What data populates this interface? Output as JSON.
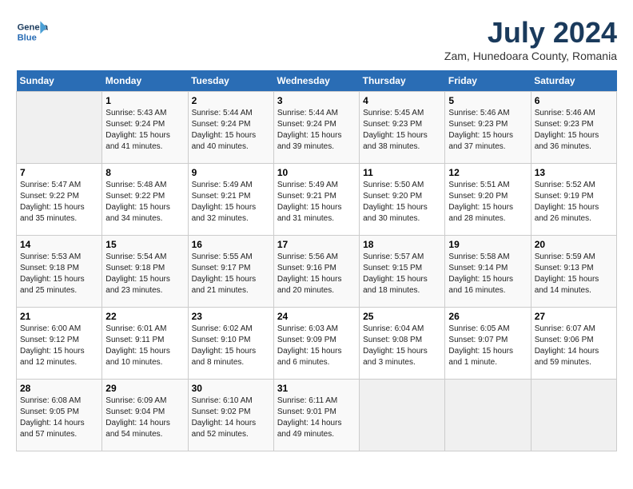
{
  "header": {
    "logo_line1": "General",
    "logo_line2": "Blue",
    "month_year": "July 2024",
    "location": "Zam, Hunedoara County, Romania"
  },
  "weekdays": [
    "Sunday",
    "Monday",
    "Tuesday",
    "Wednesday",
    "Thursday",
    "Friday",
    "Saturday"
  ],
  "weeks": [
    [
      {
        "day": "",
        "info": ""
      },
      {
        "day": "1",
        "info": "Sunrise: 5:43 AM\nSunset: 9:24 PM\nDaylight: 15 hours\nand 41 minutes."
      },
      {
        "day": "2",
        "info": "Sunrise: 5:44 AM\nSunset: 9:24 PM\nDaylight: 15 hours\nand 40 minutes."
      },
      {
        "day": "3",
        "info": "Sunrise: 5:44 AM\nSunset: 9:24 PM\nDaylight: 15 hours\nand 39 minutes."
      },
      {
        "day": "4",
        "info": "Sunrise: 5:45 AM\nSunset: 9:23 PM\nDaylight: 15 hours\nand 38 minutes."
      },
      {
        "day": "5",
        "info": "Sunrise: 5:46 AM\nSunset: 9:23 PM\nDaylight: 15 hours\nand 37 minutes."
      },
      {
        "day": "6",
        "info": "Sunrise: 5:46 AM\nSunset: 9:23 PM\nDaylight: 15 hours\nand 36 minutes."
      }
    ],
    [
      {
        "day": "7",
        "info": "Sunrise: 5:47 AM\nSunset: 9:22 PM\nDaylight: 15 hours\nand 35 minutes."
      },
      {
        "day": "8",
        "info": "Sunrise: 5:48 AM\nSunset: 9:22 PM\nDaylight: 15 hours\nand 34 minutes."
      },
      {
        "day": "9",
        "info": "Sunrise: 5:49 AM\nSunset: 9:21 PM\nDaylight: 15 hours\nand 32 minutes."
      },
      {
        "day": "10",
        "info": "Sunrise: 5:49 AM\nSunset: 9:21 PM\nDaylight: 15 hours\nand 31 minutes."
      },
      {
        "day": "11",
        "info": "Sunrise: 5:50 AM\nSunset: 9:20 PM\nDaylight: 15 hours\nand 30 minutes."
      },
      {
        "day": "12",
        "info": "Sunrise: 5:51 AM\nSunset: 9:20 PM\nDaylight: 15 hours\nand 28 minutes."
      },
      {
        "day": "13",
        "info": "Sunrise: 5:52 AM\nSunset: 9:19 PM\nDaylight: 15 hours\nand 26 minutes."
      }
    ],
    [
      {
        "day": "14",
        "info": "Sunrise: 5:53 AM\nSunset: 9:18 PM\nDaylight: 15 hours\nand 25 minutes."
      },
      {
        "day": "15",
        "info": "Sunrise: 5:54 AM\nSunset: 9:18 PM\nDaylight: 15 hours\nand 23 minutes."
      },
      {
        "day": "16",
        "info": "Sunrise: 5:55 AM\nSunset: 9:17 PM\nDaylight: 15 hours\nand 21 minutes."
      },
      {
        "day": "17",
        "info": "Sunrise: 5:56 AM\nSunset: 9:16 PM\nDaylight: 15 hours\nand 20 minutes."
      },
      {
        "day": "18",
        "info": "Sunrise: 5:57 AM\nSunset: 9:15 PM\nDaylight: 15 hours\nand 18 minutes."
      },
      {
        "day": "19",
        "info": "Sunrise: 5:58 AM\nSunset: 9:14 PM\nDaylight: 15 hours\nand 16 minutes."
      },
      {
        "day": "20",
        "info": "Sunrise: 5:59 AM\nSunset: 9:13 PM\nDaylight: 15 hours\nand 14 minutes."
      }
    ],
    [
      {
        "day": "21",
        "info": "Sunrise: 6:00 AM\nSunset: 9:12 PM\nDaylight: 15 hours\nand 12 minutes."
      },
      {
        "day": "22",
        "info": "Sunrise: 6:01 AM\nSunset: 9:11 PM\nDaylight: 15 hours\nand 10 minutes."
      },
      {
        "day": "23",
        "info": "Sunrise: 6:02 AM\nSunset: 9:10 PM\nDaylight: 15 hours\nand 8 minutes."
      },
      {
        "day": "24",
        "info": "Sunrise: 6:03 AM\nSunset: 9:09 PM\nDaylight: 15 hours\nand 6 minutes."
      },
      {
        "day": "25",
        "info": "Sunrise: 6:04 AM\nSunset: 9:08 PM\nDaylight: 15 hours\nand 3 minutes."
      },
      {
        "day": "26",
        "info": "Sunrise: 6:05 AM\nSunset: 9:07 PM\nDaylight: 15 hours\nand 1 minute."
      },
      {
        "day": "27",
        "info": "Sunrise: 6:07 AM\nSunset: 9:06 PM\nDaylight: 14 hours\nand 59 minutes."
      }
    ],
    [
      {
        "day": "28",
        "info": "Sunrise: 6:08 AM\nSunset: 9:05 PM\nDaylight: 14 hours\nand 57 minutes."
      },
      {
        "day": "29",
        "info": "Sunrise: 6:09 AM\nSunset: 9:04 PM\nDaylight: 14 hours\nand 54 minutes."
      },
      {
        "day": "30",
        "info": "Sunrise: 6:10 AM\nSunset: 9:02 PM\nDaylight: 14 hours\nand 52 minutes."
      },
      {
        "day": "31",
        "info": "Sunrise: 6:11 AM\nSunset: 9:01 PM\nDaylight: 14 hours\nand 49 minutes."
      },
      {
        "day": "",
        "info": ""
      },
      {
        "day": "",
        "info": ""
      },
      {
        "day": "",
        "info": ""
      }
    ]
  ]
}
